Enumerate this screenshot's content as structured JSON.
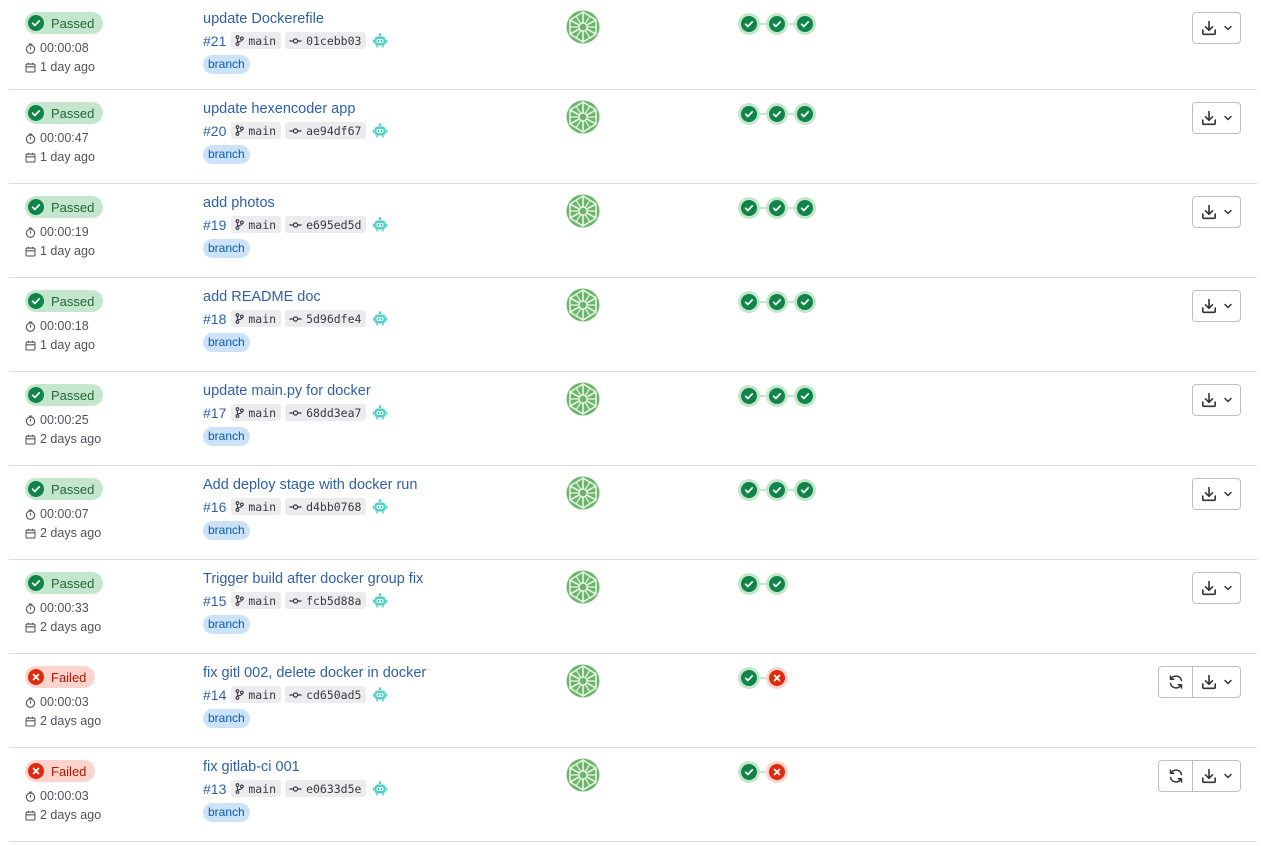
{
  "colors": {
    "link": "#2f5fa6",
    "passed_bg": "#c3e6cd",
    "passed_fg": "#108548",
    "failed_bg": "#fdd4cd",
    "failed_fg": "#dd2b0e",
    "branch_tag_bg": "#cbe2f9"
  },
  "icons": {
    "status_passed": "check-circle-icon",
    "status_failed": "x-circle-icon",
    "duration": "timer-icon",
    "date": "calendar-icon",
    "branch": "branch-icon",
    "commit": "commit-icon",
    "bot": "bot-icon",
    "retry": "retry-icon",
    "download": "download-icon",
    "dropdown": "chevron-down-icon"
  },
  "pipelines": [
    {
      "status": "passed",
      "status_label": "Passed",
      "duration": "00:00:08",
      "finished": "1 day ago",
      "title": "update Dockerefile",
      "id": "#21",
      "ref": "main",
      "sha": "01cebb03",
      "tag": "branch",
      "stages": [
        "passed",
        "passed",
        "passed"
      ]
    },
    {
      "status": "passed",
      "status_label": "Passed",
      "duration": "00:00:47",
      "finished": "1 day ago",
      "title": "update hexencoder app",
      "id": "#20",
      "ref": "main",
      "sha": "ae94df67",
      "tag": "branch",
      "stages": [
        "passed",
        "passed",
        "passed"
      ]
    },
    {
      "status": "passed",
      "status_label": "Passed",
      "duration": "00:00:19",
      "finished": "1 day ago",
      "title": "add photos",
      "id": "#19",
      "ref": "main",
      "sha": "e695ed5d",
      "tag": "branch",
      "stages": [
        "passed",
        "passed",
        "passed"
      ]
    },
    {
      "status": "passed",
      "status_label": "Passed",
      "duration": "00:00:18",
      "finished": "1 day ago",
      "title": "add README doc",
      "id": "#18",
      "ref": "main",
      "sha": "5d96dfe4",
      "tag": "branch",
      "stages": [
        "passed",
        "passed",
        "passed"
      ]
    },
    {
      "status": "passed",
      "status_label": "Passed",
      "duration": "00:00:25",
      "finished": "2 days ago",
      "title": "update main.py for docker",
      "id": "#17",
      "ref": "main",
      "sha": "68dd3ea7",
      "tag": "branch",
      "stages": [
        "passed",
        "passed",
        "passed"
      ]
    },
    {
      "status": "passed",
      "status_label": "Passed",
      "duration": "00:00:07",
      "finished": "2 days ago",
      "title": "Add deploy stage with docker run",
      "id": "#16",
      "ref": "main",
      "sha": "d4bb0768",
      "tag": "branch",
      "stages": [
        "passed",
        "passed",
        "passed"
      ]
    },
    {
      "status": "passed",
      "status_label": "Passed",
      "duration": "00:00:33",
      "finished": "2 days ago",
      "title": "Trigger build after docker group fix",
      "id": "#15",
      "ref": "main",
      "sha": "fcb5d88a",
      "tag": "branch",
      "stages": [
        "passed",
        "passed"
      ]
    },
    {
      "status": "failed",
      "status_label": "Failed",
      "duration": "00:00:03",
      "finished": "2 days ago",
      "title": "fix gitl 002, delete docker in docker",
      "id": "#14",
      "ref": "main",
      "sha": "cd650ad5",
      "tag": "branch",
      "stages": [
        "passed",
        "failed"
      ]
    },
    {
      "status": "failed",
      "status_label": "Failed",
      "duration": "00:00:03",
      "finished": "2 days ago",
      "title": "fix gitlab-ci 001",
      "id": "#13",
      "ref": "main",
      "sha": "e0633d5e",
      "tag": "branch",
      "stages": [
        "passed",
        "failed"
      ]
    }
  ]
}
